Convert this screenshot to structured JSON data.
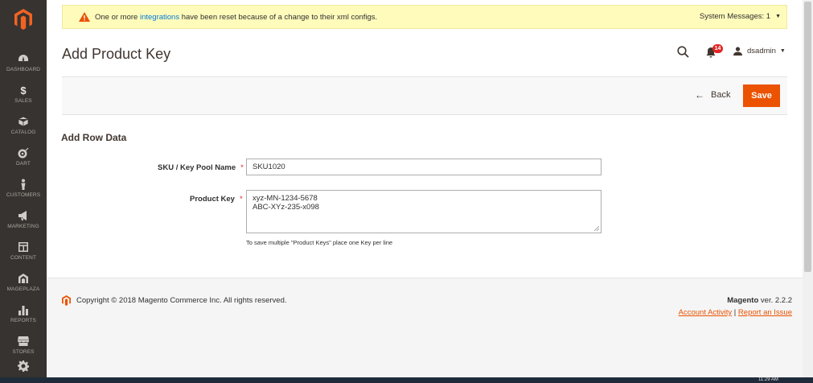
{
  "sidebar": {
    "items": [
      {
        "label": "DASHBOARD",
        "icon": "dashboard-icon"
      },
      {
        "label": "SALES",
        "icon": "dollar-icon"
      },
      {
        "label": "CATALOG",
        "icon": "cube-icon"
      },
      {
        "label": "DART",
        "icon": "target-icon"
      },
      {
        "label": "CUSTOMERS",
        "icon": "person-icon"
      },
      {
        "label": "MARKETING",
        "icon": "megaphone-icon"
      },
      {
        "label": "CONTENT",
        "icon": "layout-icon"
      },
      {
        "label": "MAGEPLAZA",
        "icon": "mageplaza-icon"
      },
      {
        "label": "REPORTS",
        "icon": "bar-chart-icon"
      },
      {
        "label": "STORES",
        "icon": "store-icon"
      },
      {
        "label": "",
        "icon": "gear-icon"
      }
    ]
  },
  "message": {
    "prefix": "One or more ",
    "link": "integrations",
    "suffix": " have been reset because of a change to their xml configs.",
    "system_messages": "System Messages: 1"
  },
  "header": {
    "title": "Add Product Key",
    "notifications_count": "14",
    "user": "dsadmin"
  },
  "actions": {
    "back": "Back",
    "save": "Save"
  },
  "form": {
    "section_title": "Add Row Data",
    "sku_label": "SKU / Key Pool Name",
    "sku_value": "SKU1020",
    "key_label": "Product Key",
    "key_lines": [
      "xyz-MN-1234-5678",
      "ABC-XYz-235-x098"
    ],
    "note": "To save multiple \"Product Keys\" place one Key per line",
    "required_mark": "*"
  },
  "footer": {
    "copyright": "Copyright © 2018 Magento Commerce Inc. All rights reserved.",
    "brand": "Magento",
    "version": " ver. 2.2.2",
    "account_activity": "Account Activity",
    "separator": " | ",
    "report_issue": "Report an Issue"
  },
  "taskbar": {
    "time": "11:29 AM"
  },
  "colors": {
    "sidebar_bg": "#373330",
    "accent": "#eb5202",
    "link": "#007bdb",
    "message_bg": "#fffbbb",
    "badge": "#e22626"
  }
}
